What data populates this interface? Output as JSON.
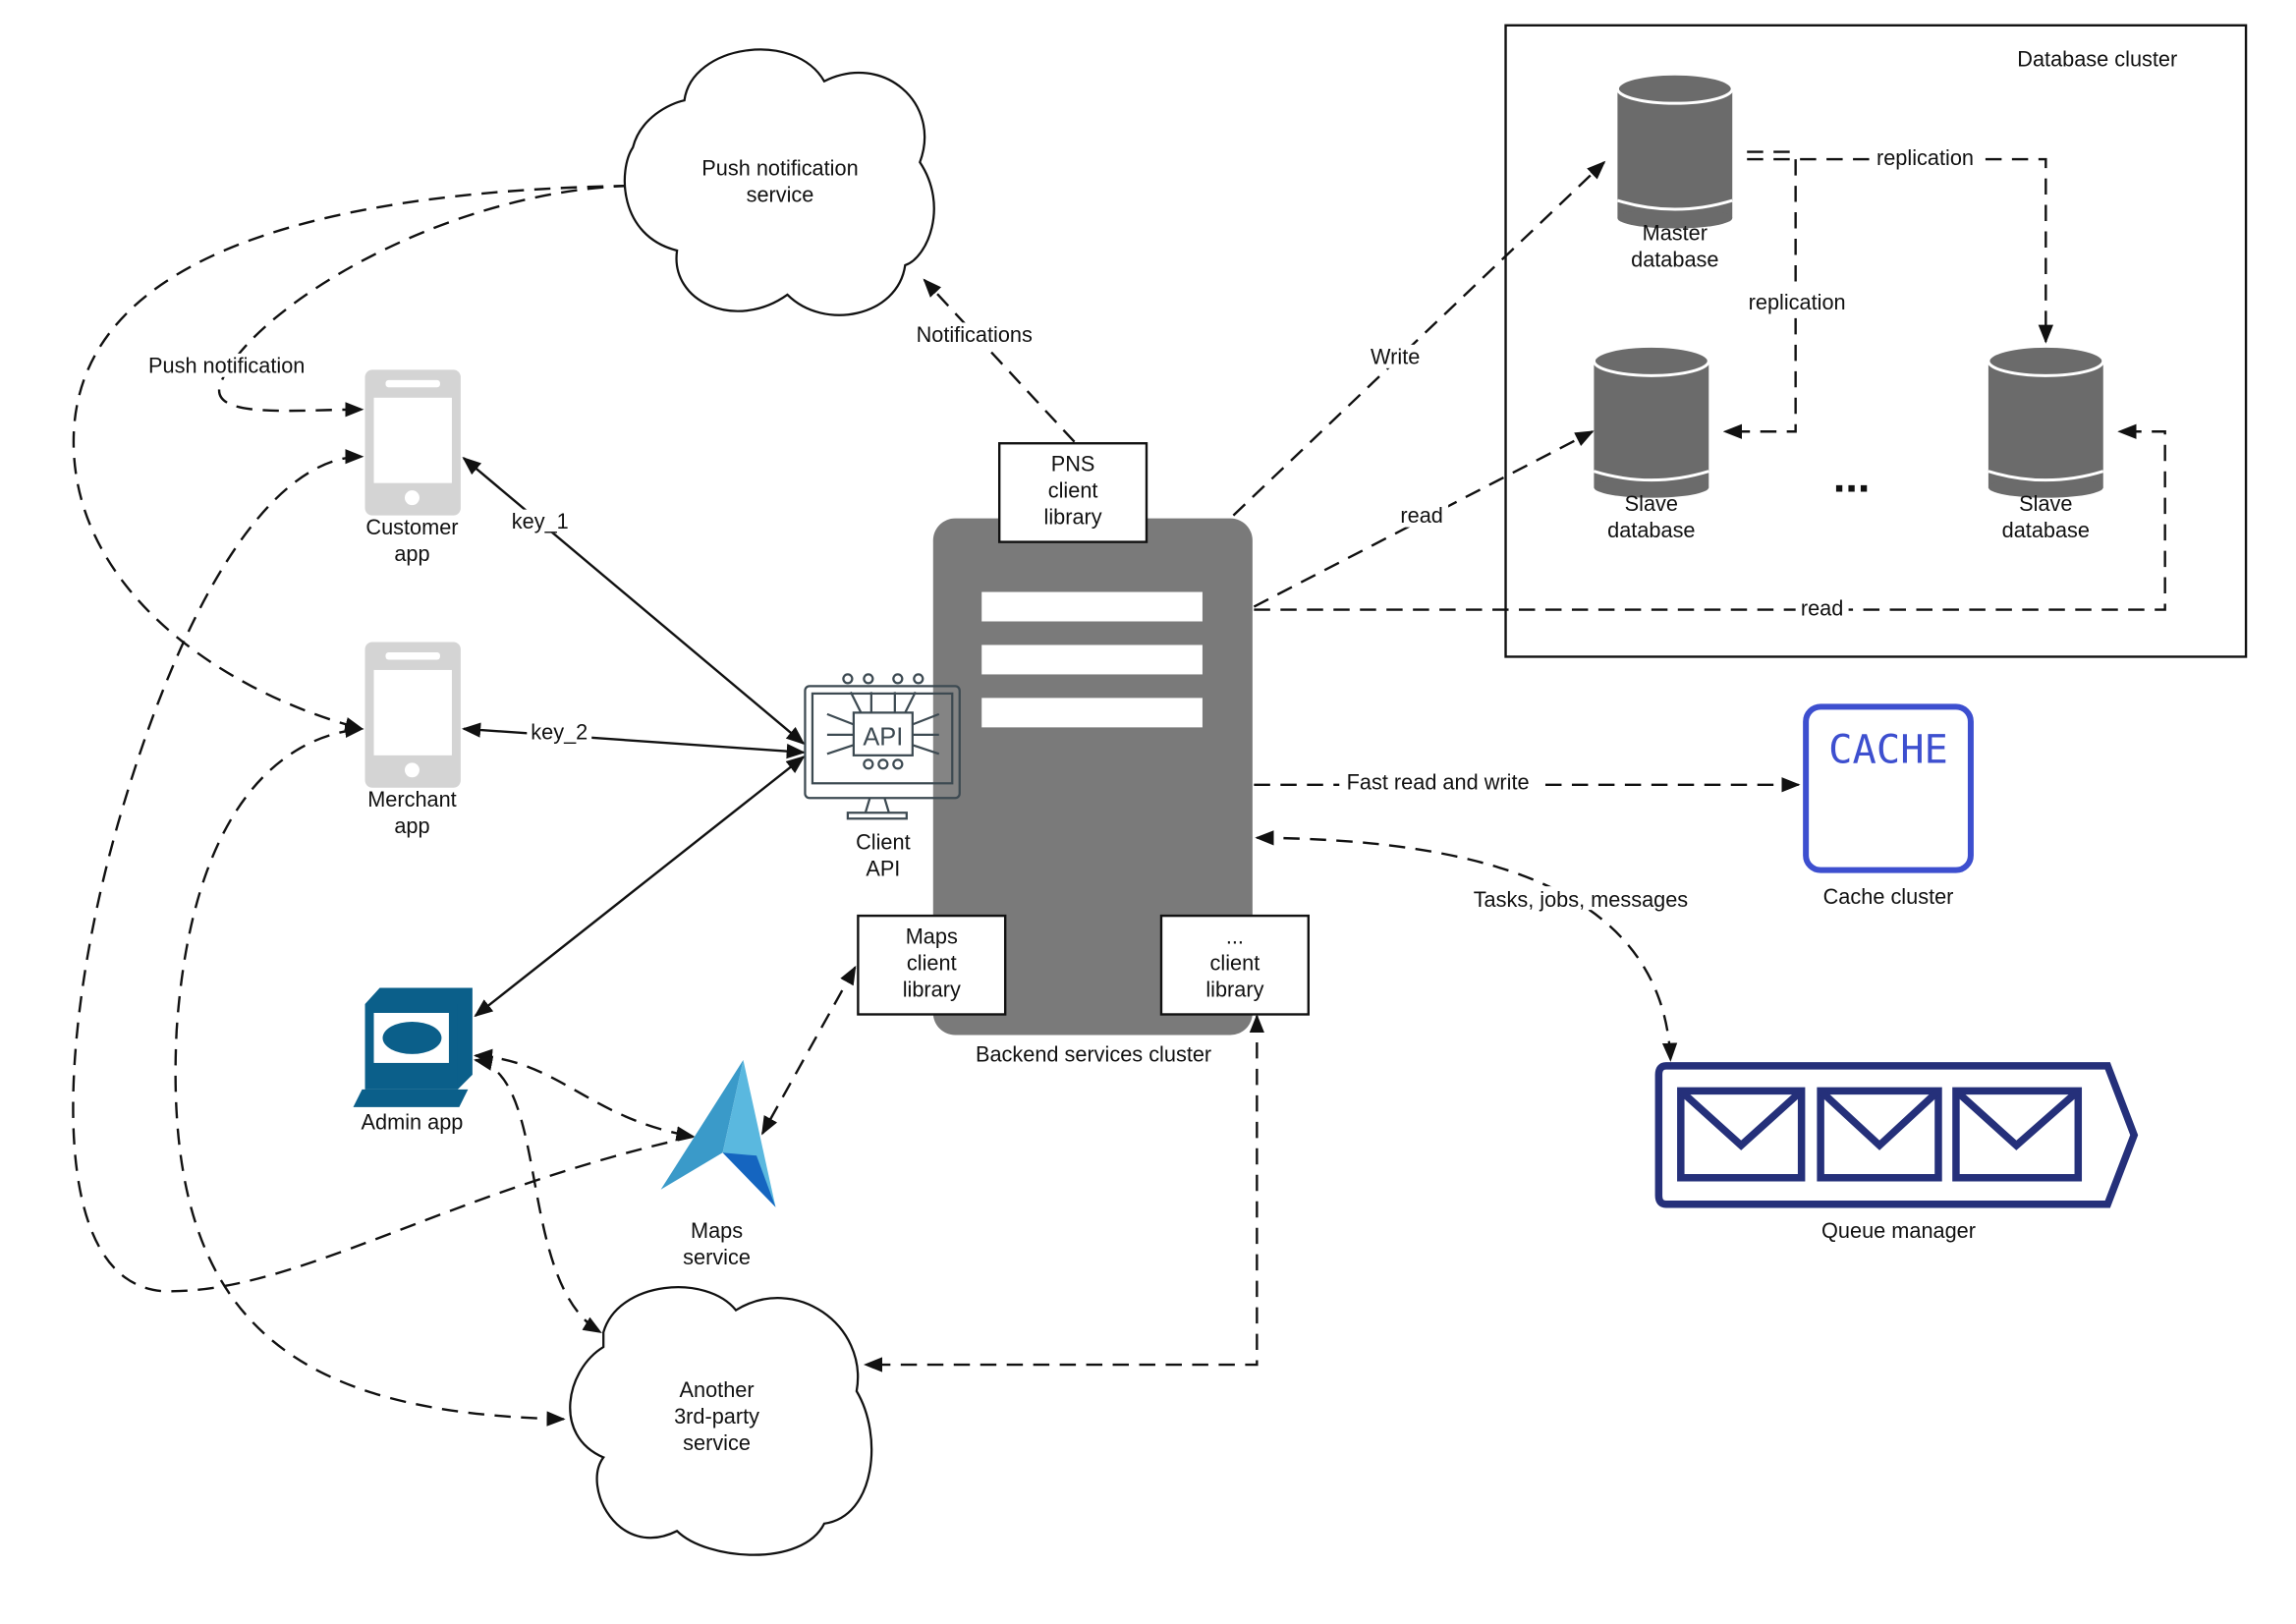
{
  "colors": {
    "server": "#7a7a7a",
    "db": "#6b6b6b",
    "phone": "#d4d4d4",
    "admin": "#0b5f8a",
    "maps_light": "#4fb0d8",
    "maps_dark": "#1565c0",
    "cache": "#3d4fcf",
    "queue": "#25307a"
  },
  "db_cluster": {
    "title": "Database cluster",
    "master": [
      "Master",
      "database"
    ],
    "slave1": [
      "Slave",
      "database"
    ],
    "slave2": [
      "Slave",
      "database"
    ],
    "ellipsis": "...",
    "replication_a": "replication",
    "replication_b": "replication"
  },
  "backend": {
    "label": "Backend services cluster",
    "pns": [
      "PNS",
      "client",
      "library"
    ],
    "maps_client": [
      "Maps",
      "client",
      "library"
    ],
    "other_client": [
      "...",
      "client",
      "library"
    ],
    "client_api_icon": "API",
    "client_api": [
      "Client",
      "API"
    ]
  },
  "clouds": {
    "push": [
      "Push notification",
      "service"
    ],
    "third_party": [
      "Another",
      "3rd-party",
      "service"
    ]
  },
  "apps": {
    "customer": [
      "Customer",
      "app"
    ],
    "merchant": [
      "Merchant",
      "app"
    ],
    "admin": "Admin app",
    "maps": [
      "Maps",
      "service"
    ]
  },
  "cache": {
    "icon_text": "CACHE",
    "label": "Cache cluster"
  },
  "queue": {
    "label": "Queue manager"
  },
  "edges": {
    "write": "Write",
    "read1": "read",
    "read2": "read",
    "fast": "Fast read and write",
    "tasks": "Tasks, jobs, messages",
    "notifications": "Notifications",
    "key1": "key_1",
    "key2": "key_2",
    "push": "Push notification"
  }
}
